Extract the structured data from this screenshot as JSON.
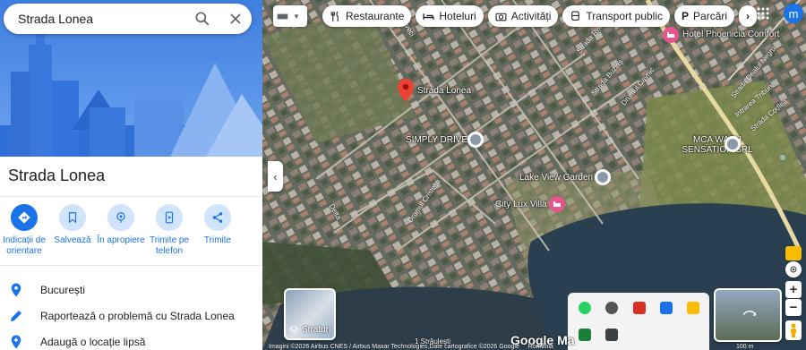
{
  "search": {
    "value": "Strada Lonea"
  },
  "place": {
    "title": "Strada Lonea"
  },
  "actions": [
    {
      "label": "Indicații de orientare",
      "icon": "directions-icon"
    },
    {
      "label": "Salvează",
      "icon": "bookmark-icon"
    },
    {
      "label": "În apropiere",
      "icon": "nearby-icon"
    },
    {
      "label": "Trimite pe telefon",
      "icon": "send-to-phone-icon"
    },
    {
      "label": "Trimite",
      "icon": "share-icon"
    }
  ],
  "details": [
    {
      "text": "București",
      "icon": "location-pin-icon"
    },
    {
      "text": "Raportează o problemă cu Strada Lonea",
      "icon": "pencil-icon"
    },
    {
      "text": "Adaugă o locație lipsă",
      "icon": "add-location-icon"
    }
  ],
  "chips": [
    {
      "label": "Restaurante",
      "icon": "restaurant-icon"
    },
    {
      "label": "Hoteluri",
      "icon": "hotel-icon"
    },
    {
      "label": "Activități",
      "icon": "camera-icon"
    },
    {
      "label": "Transport public",
      "icon": "transit-icon"
    },
    {
      "label": "Parcări",
      "icon": "parking-icon"
    }
  ],
  "account": {
    "initial": "m"
  },
  "map": {
    "pin_label": "Strada Lonea",
    "places": {
      "hotel": "Hotel Phoenicia Comfort",
      "simply": "SIMPLY DRIVE",
      "mca": "MCA WASH SENSATION SRL",
      "lakeview": "Lake View Garden",
      "citylux": "City Lux Villa"
    },
    "streets": {
      "s1": "Strada Reci",
      "s2": "Strada Buziaș",
      "s3": "Drumul Cavnic",
      "s4": "Strada Dealul Negru",
      "s5": "Intrarea Tribunei",
      "s6": "Strada Codlea",
      "s7": "Drumul Cristești",
      "s8": "Ghiveci",
      "s9": "Delta",
      "s10": "1 Străulești"
    },
    "layers_label": "Straturi",
    "footer": "Imagini ©2026 Airbus CNES / Airbus Maxar Technologies,Date cartografice ©2026 Google",
    "logo": "Google Ma",
    "country": "România",
    "scale": "100 m",
    "zoom_in": "+",
    "zoom_out": "−"
  },
  "colors": {
    "accent": "#1a73e8",
    "lake": "#2a4050",
    "pin": "#ea4335",
    "hotel_pin": "#e8548c"
  }
}
